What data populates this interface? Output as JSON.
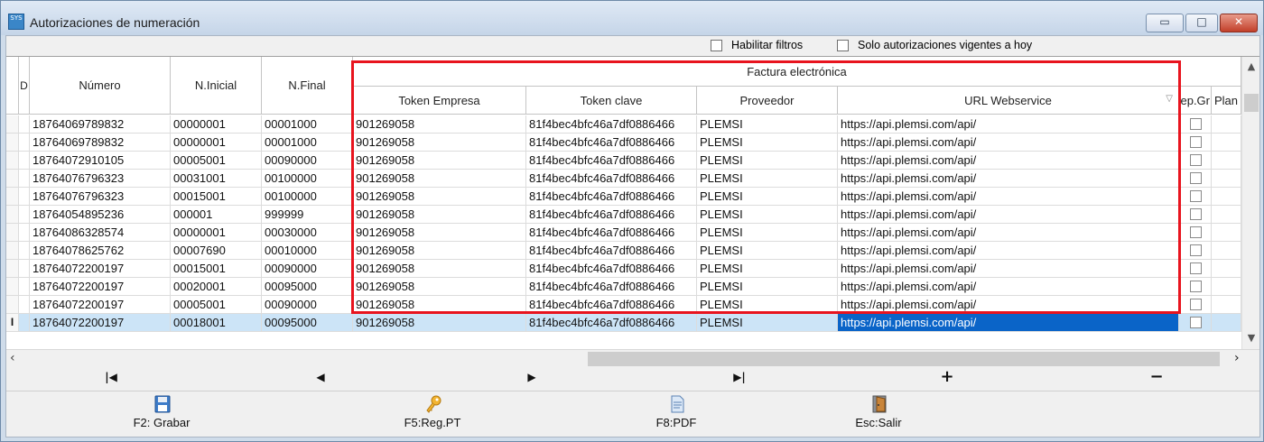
{
  "window": {
    "title": "Autorizaciones de numeración",
    "app_icon_text": "SYS",
    "controls": {
      "minimize": "▭",
      "maximize": "□",
      "close": "✕"
    }
  },
  "filters": [
    {
      "label": "Habilitar filtros",
      "checked": false
    },
    {
      "label": "Solo autorizaciones vigentes a hoy",
      "checked": false
    }
  ],
  "grid": {
    "columns": {
      "d": "D",
      "numero": "Número",
      "n_inicial": "N.Inicial",
      "n_final": "N.Final",
      "group_title": "Factura electrónica",
      "token_empresa": "Token Empresa",
      "token_clave": "Token clave",
      "proveedor": "Proveedor",
      "url_webservice": "URL Webservice",
      "rep_gr": "ep.Gr",
      "plan": "Plan"
    },
    "current_row_indicator": "I",
    "rows": [
      {
        "numero": "18764069789832",
        "n_inicial": "00000001",
        "n_final": "00001000",
        "token_empresa": "901269058",
        "token_clave": "81f4bec4bfc46a7df0886466",
        "proveedor": "PLEMSI",
        "url": "https://api.plemsi.com/api/",
        "rep_gr": false
      },
      {
        "numero": "18764069789832",
        "n_inicial": "00000001",
        "n_final": "00001000",
        "token_empresa": "901269058",
        "token_clave": "81f4bec4bfc46a7df0886466",
        "proveedor": "PLEMSI",
        "url": "https://api.plemsi.com/api/",
        "rep_gr": false
      },
      {
        "numero": "18764072910105",
        "n_inicial": "00005001",
        "n_final": "00090000",
        "token_empresa": "901269058",
        "token_clave": "81f4bec4bfc46a7df0886466",
        "proveedor": "PLEMSI",
        "url": "https://api.plemsi.com/api/",
        "rep_gr": false
      },
      {
        "numero": "18764076796323",
        "n_inicial": "00031001",
        "n_final": "00100000",
        "token_empresa": "901269058",
        "token_clave": "81f4bec4bfc46a7df0886466",
        "proveedor": "PLEMSI",
        "url": "https://api.plemsi.com/api/",
        "rep_gr": false
      },
      {
        "numero": "18764076796323",
        "n_inicial": "00015001",
        "n_final": "00100000",
        "token_empresa": "901269058",
        "token_clave": "81f4bec4bfc46a7df0886466",
        "proveedor": "PLEMSI",
        "url": "https://api.plemsi.com/api/",
        "rep_gr": false
      },
      {
        "numero": "18764054895236",
        "n_inicial": "000001",
        "n_final": "999999",
        "token_empresa": "901269058",
        "token_clave": "81f4bec4bfc46a7df0886466",
        "proveedor": "PLEMSI",
        "url": "https://api.plemsi.com/api/",
        "rep_gr": false
      },
      {
        "numero": "18764086328574",
        "n_inicial": "00000001",
        "n_final": "00030000",
        "token_empresa": "901269058",
        "token_clave": "81f4bec4bfc46a7df0886466",
        "proveedor": "PLEMSI",
        "url": "https://api.plemsi.com/api/",
        "rep_gr": false
      },
      {
        "numero": "18764078625762",
        "n_inicial": "00007690",
        "n_final": "00010000",
        "token_empresa": "901269058",
        "token_clave": "81f4bec4bfc46a7df0886466",
        "proveedor": "PLEMSI",
        "url": "https://api.plemsi.com/api/",
        "rep_gr": false
      },
      {
        "numero": "18764072200197",
        "n_inicial": "00015001",
        "n_final": "00090000",
        "token_empresa": "901269058",
        "token_clave": "81f4bec4bfc46a7df0886466",
        "proveedor": "PLEMSI",
        "url": "https://api.plemsi.com/api/",
        "rep_gr": false
      },
      {
        "numero": "18764072200197",
        "n_inicial": "00020001",
        "n_final": "00095000",
        "token_empresa": "901269058",
        "token_clave": "81f4bec4bfc46a7df0886466",
        "proveedor": "PLEMSI",
        "url": "https://api.plemsi.com/api/",
        "rep_gr": false
      },
      {
        "numero": "18764072200197",
        "n_inicial": "00005001",
        "n_final": "00090000",
        "token_empresa": "901269058",
        "token_clave": "81f4bec4bfc46a7df0886466",
        "proveedor": "PLEMSI",
        "url": "https://api.plemsi.com/api/",
        "rep_gr": false
      },
      {
        "numero": "18764072200197",
        "n_inicial": "00018001",
        "n_final": "00095000",
        "token_empresa": "901269058",
        "token_clave": "81f4bec4bfc46a7df0886466",
        "proveedor": "PLEMSI",
        "url": "https://api.plemsi.com/api/",
        "rep_gr": false,
        "selected": true
      }
    ]
  },
  "navigator": [
    {
      "name": "nav-first-button",
      "glyph": "|◀"
    },
    {
      "name": "nav-prev-button",
      "glyph": "◀"
    },
    {
      "name": "nav-next-button",
      "glyph": "▶"
    },
    {
      "name": "nav-last-button",
      "glyph": "▶|"
    },
    {
      "name": "nav-add-button",
      "glyph": "+"
    },
    {
      "name": "nav-delete-button",
      "glyph": "−"
    }
  ],
  "actions": [
    {
      "name": "save-button",
      "icon": "floppy-disk-icon",
      "label": "F2: Grabar"
    },
    {
      "name": "reg-pt-button",
      "icon": "key-icon",
      "label": "F5:Reg.PT"
    },
    {
      "name": "pdf-button",
      "icon": "document-icon",
      "label": "F8:PDF"
    },
    {
      "name": "exit-button",
      "icon": "exit-door-icon",
      "label": "Esc:Salir"
    }
  ],
  "colors": {
    "selected_row": "#cce4f7",
    "focused_cell": "#0a64c8",
    "highlight_box": "#e8141e"
  }
}
